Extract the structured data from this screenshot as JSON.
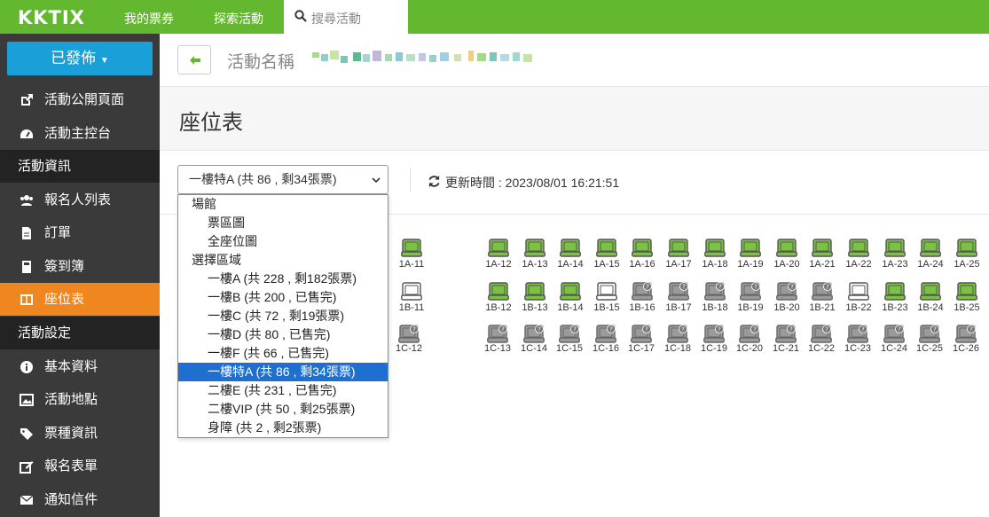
{
  "topbar": {
    "logo": "KKTIX",
    "nav": [
      "我的票券",
      "探索活動"
    ],
    "search_placeholder": "搜尋活動"
  },
  "sidebar": {
    "publish_label": "已發佈",
    "items": [
      {
        "label": "活動公開頁面",
        "icon": "external-link-icon"
      },
      {
        "label": "活動主控台",
        "icon": "dashboard-icon"
      }
    ],
    "section1": "活動資訊",
    "info_items": [
      {
        "label": "報名人列表",
        "icon": "users-icon"
      },
      {
        "label": "訂單",
        "icon": "file-icon"
      },
      {
        "label": "簽到簿",
        "icon": "book-icon"
      },
      {
        "label": "座位表",
        "icon": "seat-map-icon",
        "active": true
      }
    ],
    "section2": "活動設定",
    "setting_items": [
      {
        "label": "基本資料",
        "icon": "info-icon"
      },
      {
        "label": "活動地點",
        "icon": "picture-icon"
      },
      {
        "label": "票種資訊",
        "icon": "tags-icon"
      },
      {
        "label": "報名表單",
        "icon": "edit-icon"
      },
      {
        "label": "通知信件",
        "icon": "envelope-icon"
      }
    ]
  },
  "breadcrumb": {
    "label": "活動名稱",
    "event_name_pixelated": true
  },
  "page_title": "座位表",
  "toolbar": {
    "selected_area": "一樓特A (共 86 , 剩34張票)",
    "refresh_text": "更新時間 : 2023/08/01 16:21:51"
  },
  "dropdown": [
    {
      "type": "group",
      "label": "場館"
    },
    {
      "type": "opt",
      "label": "票區圖"
    },
    {
      "type": "opt",
      "label": "全座位圖"
    },
    {
      "type": "group",
      "label": "選擇區域"
    },
    {
      "type": "opt",
      "label": "一樓A (共 228 , 剩182張票)"
    },
    {
      "type": "opt",
      "label": "一樓B (共 200 , 已售完)"
    },
    {
      "type": "opt",
      "label": "一樓C (共 72 , 剩19張票)"
    },
    {
      "type": "opt",
      "label": "一樓D (共 80 , 已售完)"
    },
    {
      "type": "opt",
      "label": "一樓F (共 66 , 已售完)"
    },
    {
      "type": "opt",
      "label": "一樓特A (共 86 , 剩34張票)",
      "selected": true
    },
    {
      "type": "opt",
      "label": "二樓E (共 231 , 已售完)"
    },
    {
      "type": "opt",
      "label": "二樓VIP (共 50 , 剩25張票)"
    },
    {
      "type": "opt",
      "label": "身障 (共 2 , 剩2張票)"
    }
  ],
  "seat_colors": {
    "available": "#7cc242",
    "empty": "#ffffff",
    "sold": "#9a9a9a"
  },
  "seat_rows": [
    [
      {
        "label": "1A-11",
        "status": "available"
      },
      {
        "label": "1A-12",
        "status": "available"
      },
      {
        "label": "1A-13",
        "status": "available"
      },
      {
        "label": "1A-14",
        "status": "available"
      },
      {
        "label": "1A-15",
        "status": "available"
      },
      {
        "label": "1A-16",
        "status": "available"
      },
      {
        "label": "1A-17",
        "status": "available"
      },
      {
        "label": "1A-18",
        "status": "available"
      },
      {
        "label": "1A-19",
        "status": "available"
      },
      {
        "label": "1A-20",
        "status": "available"
      },
      {
        "label": "1A-21",
        "status": "available"
      },
      {
        "label": "1A-22",
        "status": "available"
      },
      {
        "label": "1A-23",
        "status": "available"
      },
      {
        "label": "1A-24",
        "status": "available"
      },
      {
        "label": "1A-25",
        "status": "available"
      }
    ],
    [
      {
        "label": "1B-11",
        "status": "empty"
      },
      {
        "label": "1B-12",
        "status": "available"
      },
      {
        "label": "1B-13",
        "status": "available"
      },
      {
        "label": "1B-14",
        "status": "available"
      },
      {
        "label": "1B-15",
        "status": "empty"
      },
      {
        "label": "1B-16",
        "status": "sold"
      },
      {
        "label": "1B-17",
        "status": "sold"
      },
      {
        "label": "1B-18",
        "status": "sold"
      },
      {
        "label": "1B-19",
        "status": "sold"
      },
      {
        "label": "1B-20",
        "status": "sold"
      },
      {
        "label": "1B-21",
        "status": "sold"
      },
      {
        "label": "1B-22",
        "status": "empty"
      },
      {
        "label": "1B-23",
        "status": "available"
      },
      {
        "label": "1B-24",
        "status": "available"
      },
      {
        "label": "1B-25",
        "status": "available"
      }
    ],
    [
      {
        "label": "1C-12",
        "status": "sold"
      },
      {
        "label": "1C-13",
        "status": "sold"
      },
      {
        "label": "1C-14",
        "status": "sold"
      },
      {
        "label": "1C-15",
        "status": "sold"
      },
      {
        "label": "1C-16",
        "status": "sold"
      },
      {
        "label": "1C-17",
        "status": "sold"
      },
      {
        "label": "1C-18",
        "status": "sold"
      },
      {
        "label": "1C-19",
        "status": "sold"
      },
      {
        "label": "1C-20",
        "status": "sold"
      },
      {
        "label": "1C-21",
        "status": "sold"
      },
      {
        "label": "1C-22",
        "status": "sold"
      },
      {
        "label": "1C-23",
        "status": "sold"
      },
      {
        "label": "1C-24",
        "status": "sold"
      },
      {
        "label": "1C-25",
        "status": "sold"
      },
      {
        "label": "1C-26",
        "status": "sold"
      }
    ]
  ]
}
